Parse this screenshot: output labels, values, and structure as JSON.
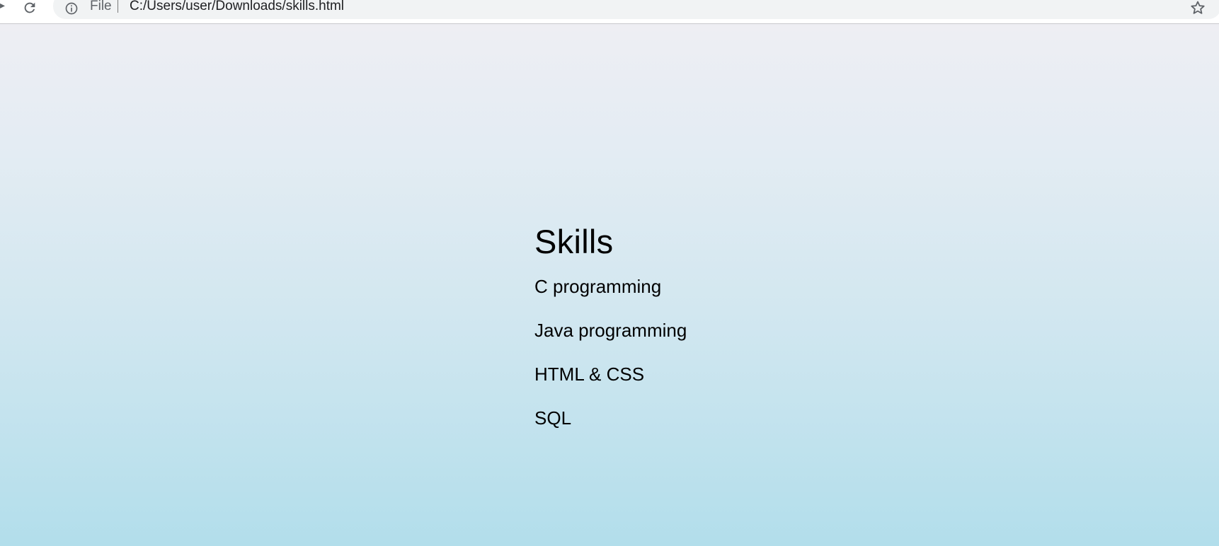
{
  "browser": {
    "scheme_label": "File",
    "url": "C:/Users/user/Downloads/skills.html",
    "icons": {
      "reload": "reload-icon",
      "info": "info-icon",
      "bookmark": "star-icon"
    }
  },
  "page": {
    "title": "Skills",
    "skills": [
      "C programming",
      "Java programming",
      "HTML & CSS",
      "SQL"
    ],
    "colors": {
      "gradient_top": "#eeeef3",
      "gradient_bottom": "#b2deeb",
      "text": "#000000"
    }
  }
}
